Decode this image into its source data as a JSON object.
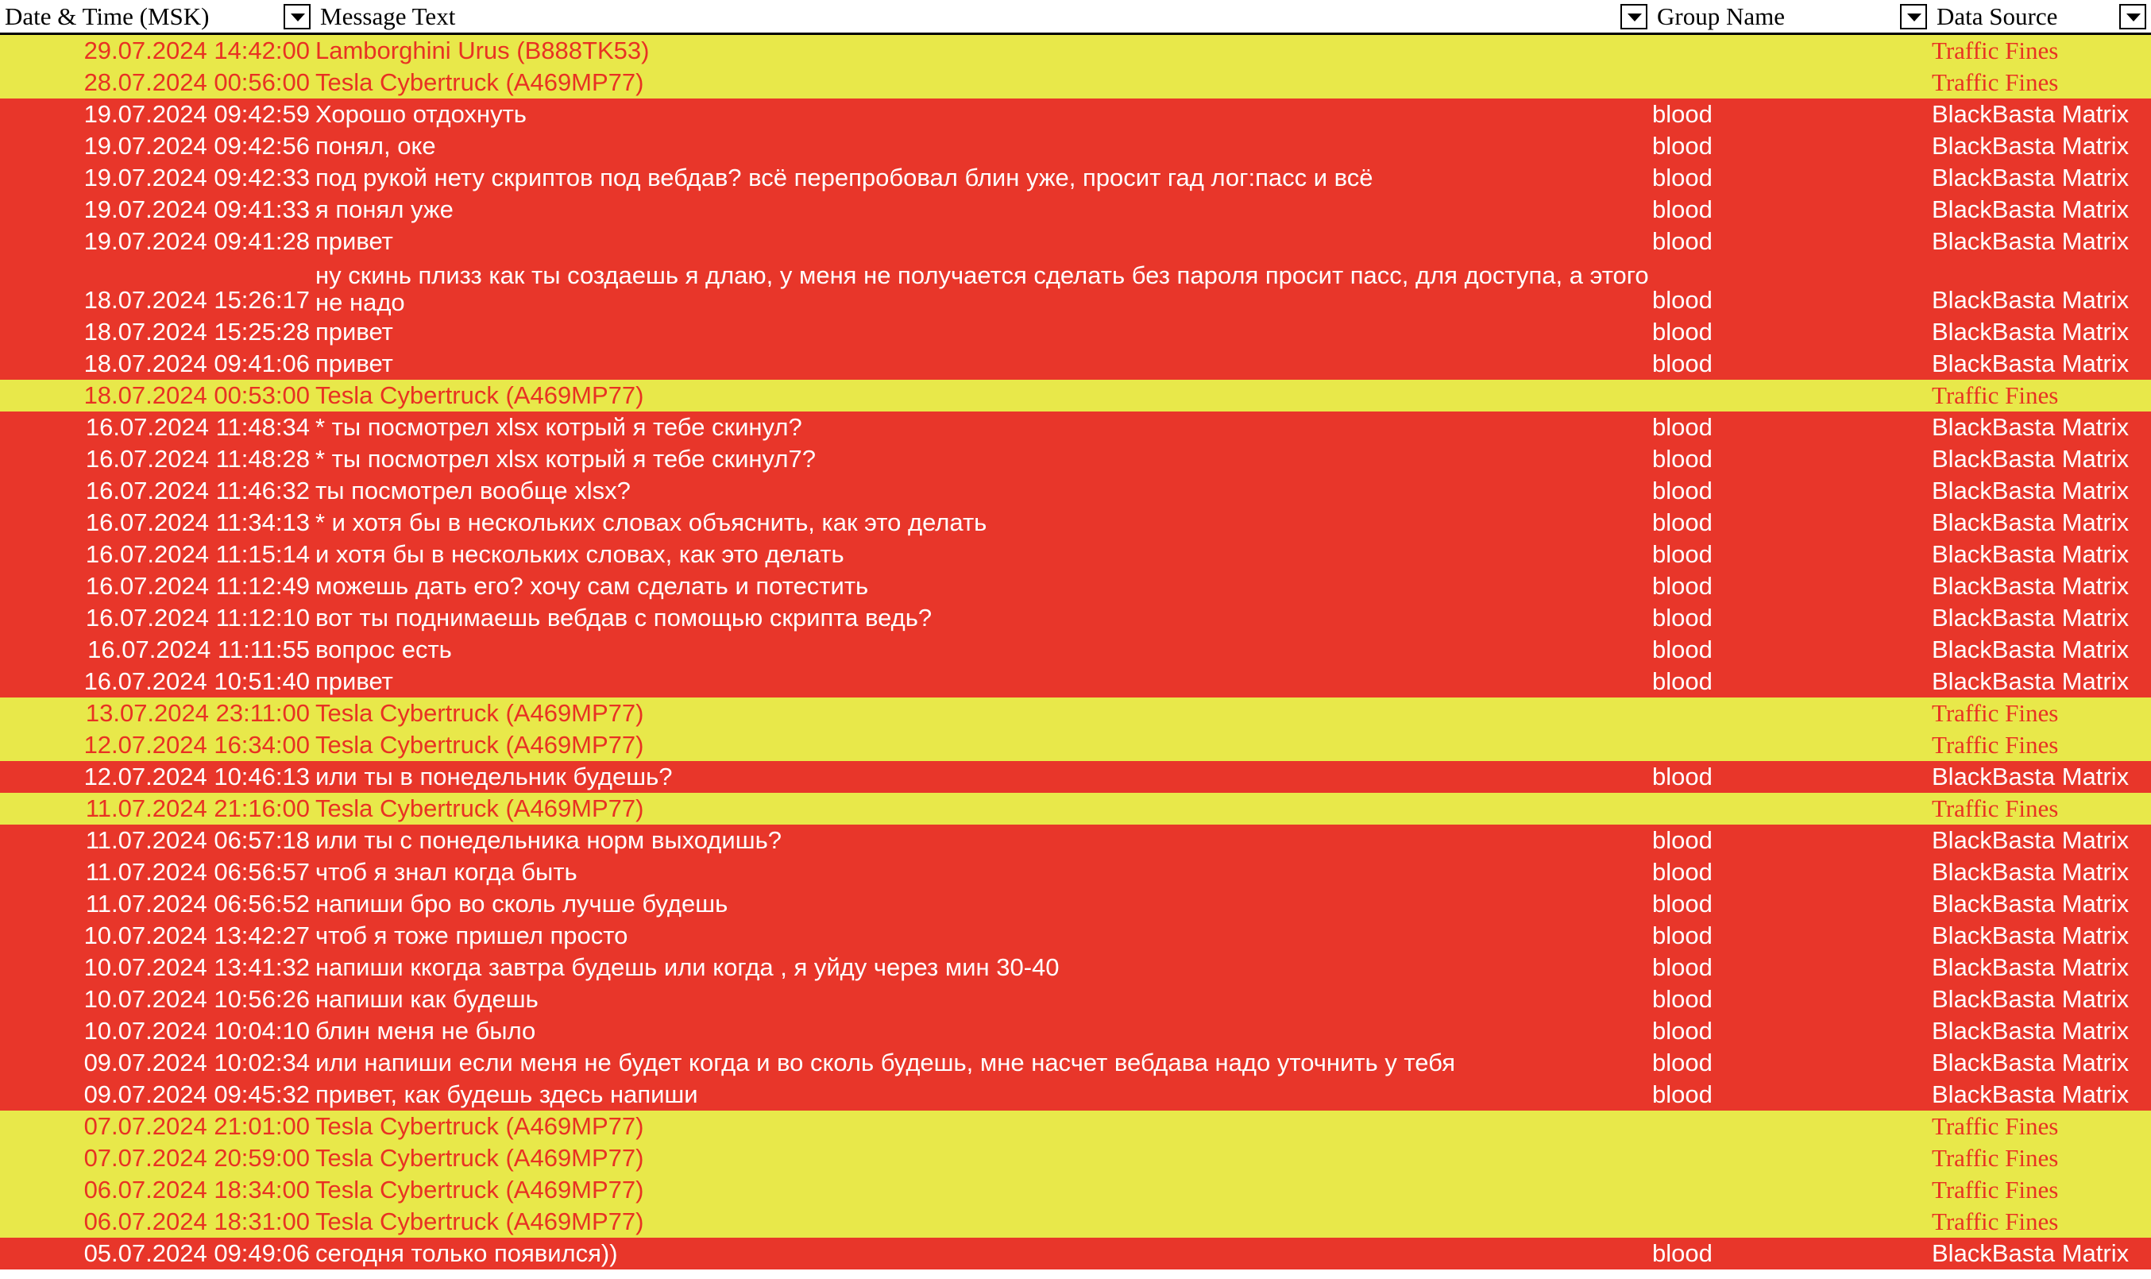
{
  "columns": {
    "datetime": "Date & Time (MSK)",
    "message": "Message Text",
    "group": "Group Name",
    "source": "Data Source"
  },
  "colors": {
    "red_row": "#e8362a",
    "yellow_row": "#e8e84a",
    "yellow_text": "#e83222"
  },
  "rows": [
    {
      "type": "yellow",
      "dt": "29.07.2024 14:42:00",
      "msg": "Lamborghini Urus (B888TK53)",
      "grp": "",
      "src": "Traffic Fines"
    },
    {
      "type": "yellow",
      "dt": "28.07.2024 00:56:00",
      "msg": "Tesla Cybertruck (A469MP77)",
      "grp": "",
      "src": "Traffic Fines"
    },
    {
      "type": "red",
      "dt": "19.07.2024 09:42:59",
      "msg": "Хорошо отдохнуть",
      "grp": "blood",
      "src": "BlackBasta Matrix"
    },
    {
      "type": "red",
      "dt": "19.07.2024 09:42:56",
      "msg": "понял, оке",
      "grp": "blood",
      "src": "BlackBasta Matrix"
    },
    {
      "type": "red",
      "dt": "19.07.2024 09:42:33",
      "msg": "под рукой нету скриптов под вебдав? всё перепробовал блин уже, просит гад лог:пасс и всё",
      "grp": "blood",
      "src": "BlackBasta Matrix"
    },
    {
      "type": "red",
      "dt": "19.07.2024 09:41:33",
      "msg": "я понял уже",
      "grp": "blood",
      "src": "BlackBasta Matrix"
    },
    {
      "type": "red",
      "dt": "19.07.2024 09:41:28",
      "msg": "привет",
      "grp": "blood",
      "src": "BlackBasta Matrix"
    },
    {
      "type": "red",
      "tall": true,
      "dt": "18.07.2024 15:26:17",
      "msg": "ну скинь плизз как ты создаешь я длаю, у меня не получается сделать без пароля просит пасс, для доступа, а этого не надо",
      "grp": "blood",
      "src": "BlackBasta Matrix"
    },
    {
      "type": "red",
      "dt": "18.07.2024 15:25:28",
      "msg": "привет",
      "grp": "blood",
      "src": "BlackBasta Matrix"
    },
    {
      "type": "red",
      "dt": "18.07.2024 09:41:06",
      "msg": "привет",
      "grp": "blood",
      "src": "BlackBasta Matrix"
    },
    {
      "type": "yellow",
      "dt": "18.07.2024 00:53:00",
      "msg": "Tesla Cybertruck (A469MP77)",
      "grp": "",
      "src": "Traffic Fines"
    },
    {
      "type": "red",
      "dt": "16.07.2024 11:48:34",
      "msg": "* ты посмотрел xlsx котрый я тебе скинул?",
      "grp": "blood",
      "src": "BlackBasta Matrix"
    },
    {
      "type": "red",
      "dt": "16.07.2024 11:48:28",
      "msg": "* ты посмотрел xlsx котрый я тебе скинул7?",
      "grp": "blood",
      "src": "BlackBasta Matrix"
    },
    {
      "type": "red",
      "dt": "16.07.2024 11:46:32",
      "msg": "ты посмотрел вообще xlsx?",
      "grp": "blood",
      "src": "BlackBasta Matrix"
    },
    {
      "type": "red",
      "dt": "16.07.2024 11:34:13",
      "msg": "* и хотя бы в нескольких словах объяснить, как это делать",
      "grp": "blood",
      "src": "BlackBasta Matrix"
    },
    {
      "type": "red",
      "dt": "16.07.2024 11:15:14",
      "msg": "и хотя бы в нескольких словах, как это делать",
      "grp": "blood",
      "src": "BlackBasta Matrix"
    },
    {
      "type": "red",
      "dt": "16.07.2024 11:12:49",
      "msg": "можешь дать его? хочу сам сделать и потестить",
      "grp": "blood",
      "src": "BlackBasta Matrix"
    },
    {
      "type": "red",
      "dt": "16.07.2024 11:12:10",
      "msg": "вот ты поднимаешь вебдав с помощью скрипта ведь?",
      "grp": "blood",
      "src": "BlackBasta Matrix"
    },
    {
      "type": "red",
      "dt": "16.07.2024 11:11:55",
      "msg": "вопрос есть",
      "grp": "blood",
      "src": "BlackBasta Matrix"
    },
    {
      "type": "red",
      "dt": "16.07.2024 10:51:40",
      "msg": "привет",
      "grp": "blood",
      "src": "BlackBasta Matrix"
    },
    {
      "type": "yellow",
      "dt": "13.07.2024 23:11:00",
      "msg": "Tesla Cybertruck (A469MP77)",
      "grp": "",
      "src": "Traffic Fines"
    },
    {
      "type": "yellow",
      "dt": "12.07.2024 16:34:00",
      "msg": "Tesla Cybertruck (A469MP77)",
      "grp": "",
      "src": "Traffic Fines"
    },
    {
      "type": "red",
      "dt": "12.07.2024 10:46:13",
      "msg": "или ты в понедельник будешь?",
      "grp": "blood",
      "src": "BlackBasta Matrix"
    },
    {
      "type": "yellow",
      "dt": "11.07.2024 21:16:00",
      "msg": "Tesla Cybertruck (A469MP77)",
      "grp": "",
      "src": "Traffic Fines"
    },
    {
      "type": "red",
      "dt": "11.07.2024 06:57:18",
      "msg": "или ты с понедельника норм выходишь?",
      "grp": "blood",
      "src": "BlackBasta Matrix"
    },
    {
      "type": "red",
      "dt": "11.07.2024 06:56:57",
      "msg": "чтоб я знал когда быть",
      "grp": "blood",
      "src": "BlackBasta Matrix"
    },
    {
      "type": "red",
      "dt": "11.07.2024 06:56:52",
      "msg": "напиши бро во сколь лучше будешь",
      "grp": "blood",
      "src": "BlackBasta Matrix"
    },
    {
      "type": "red",
      "dt": "10.07.2024 13:42:27",
      "msg": "чтоб я тоже пришел просто",
      "grp": "blood",
      "src": "BlackBasta Matrix"
    },
    {
      "type": "red",
      "dt": "10.07.2024 13:41:32",
      "msg": "напиши ккогда завтра будешь или когда , я уйду через мин 30-40",
      "grp": "blood",
      "src": "BlackBasta Matrix"
    },
    {
      "type": "red",
      "dt": "10.07.2024 10:56:26",
      "msg": "напиши как будешь",
      "grp": "blood",
      "src": "BlackBasta Matrix"
    },
    {
      "type": "red",
      "dt": "10.07.2024 10:04:10",
      "msg": "блин меня не было",
      "grp": "blood",
      "src": "BlackBasta Matrix"
    },
    {
      "type": "red",
      "dt": "09.07.2024 10:02:34",
      "msg": "или напиши если меня не будет когда и во сколь будешь, мне насчет вебдава надо уточнить у тебя",
      "grp": "blood",
      "src": "BlackBasta Matrix"
    },
    {
      "type": "red",
      "dt": "09.07.2024 09:45:32",
      "msg": "привет, как будешь здесь напиши",
      "grp": "blood",
      "src": "BlackBasta Matrix"
    },
    {
      "type": "yellow",
      "dt": "07.07.2024 21:01:00",
      "msg": "Tesla Cybertruck (A469MP77)",
      "grp": "",
      "src": "Traffic Fines"
    },
    {
      "type": "yellow",
      "dt": "07.07.2024 20:59:00",
      "msg": "Tesla Cybertruck (A469MP77)",
      "grp": "",
      "src": "Traffic Fines"
    },
    {
      "type": "yellow",
      "dt": "06.07.2024 18:34:00",
      "msg": "Tesla Cybertruck (A469MP77)",
      "grp": "",
      "src": "Traffic Fines"
    },
    {
      "type": "yellow",
      "dt": "06.07.2024 18:31:00",
      "msg": "Tesla Cybertruck (A469MP77)",
      "grp": "",
      "src": "Traffic Fines"
    },
    {
      "type": "red",
      "dt": "05.07.2024 09:49:06",
      "msg": "сегодня только появился))",
      "grp": "blood",
      "src": "BlackBasta Matrix"
    }
  ]
}
